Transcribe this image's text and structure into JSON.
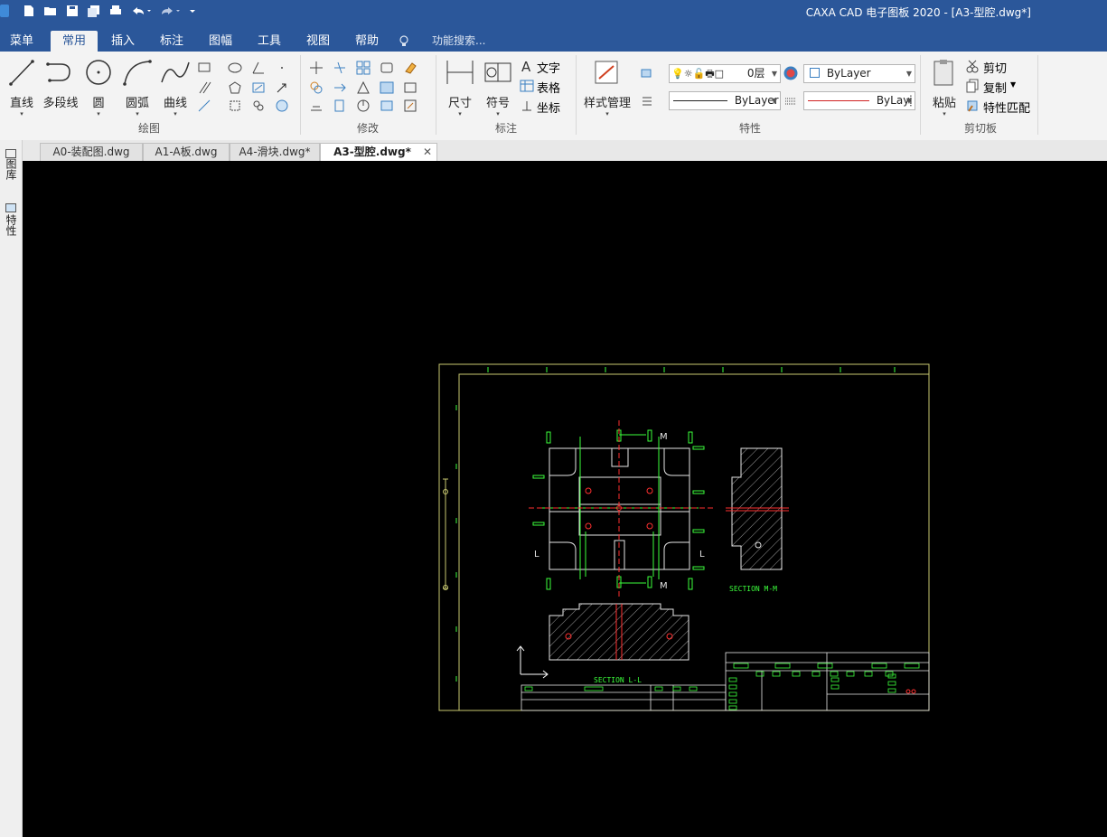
{
  "window": {
    "title": "CAXA CAD 电子图板 2020 - [A3-型腔.dwg*]"
  },
  "menu": {
    "items": [
      "菜单",
      "常用",
      "插入",
      "标注",
      "图幅",
      "工具",
      "视图",
      "帮助"
    ],
    "search_placeholder": "功能搜索..."
  },
  "ribbon": {
    "draw": {
      "label": "绘图",
      "tools": [
        "直线",
        "多段线",
        "圆",
        "圆弧",
        "曲线"
      ]
    },
    "modify": {
      "label": "修改"
    },
    "annotate": {
      "label": "标注",
      "tools": [
        "尺寸",
        "符号"
      ],
      "small": [
        "文字",
        "表格",
        "坐标"
      ]
    },
    "properties": {
      "label": "特性",
      "style_manager": "样式管理",
      "layer_value": "0层",
      "color_value": "ByLayer",
      "linetype_value": "ByLayer",
      "lineweight_value": "ByLayị"
    },
    "clipboard": {
      "label": "剪切板",
      "paste": "粘贴",
      "cut": "剪切",
      "copy": "复制",
      "match": "特性匹配"
    }
  },
  "doc_tabs": [
    {
      "name": "A0-装配图.dwg",
      "active": false
    },
    {
      "name": "A1-A板.dwg",
      "active": false
    },
    {
      "name": "A4-滑块.dwg*",
      "active": false
    },
    {
      "name": "A3-型腔.dwg*",
      "active": true
    }
  ],
  "side_panel": {
    "items": [
      "图库",
      "特性"
    ]
  },
  "drawing": {
    "section_mm": "SECTION M-M",
    "section_ll": "SECTION L-L",
    "label_m": "M",
    "label_l": "L"
  },
  "colors": {
    "accent": "#2b579a",
    "sheet_border": "#c8c870",
    "cad_green": "#3cff3c",
    "cad_red": "#ff3030",
    "cad_white": "#e6e6e6"
  }
}
